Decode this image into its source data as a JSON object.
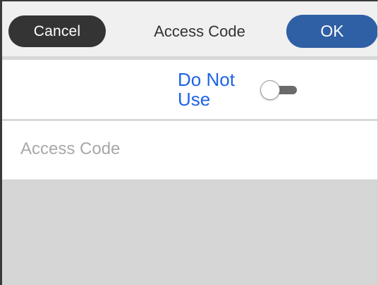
{
  "header": {
    "cancel_label": "Cancel",
    "title": "Access Code",
    "ok_label": "OK"
  },
  "settings": {
    "do_not_use_label": "Do Not\nUse",
    "do_not_use_enabled": false
  },
  "access_code_field": {
    "placeholder": "Access Code",
    "value": ""
  },
  "colors": {
    "cancel_button": "#343434",
    "ok_button": "#2f5fa4",
    "toggle_label": "#1f63e6",
    "placeholder": "#a8a8a8",
    "bottom_panel": "#d6d6d6"
  }
}
